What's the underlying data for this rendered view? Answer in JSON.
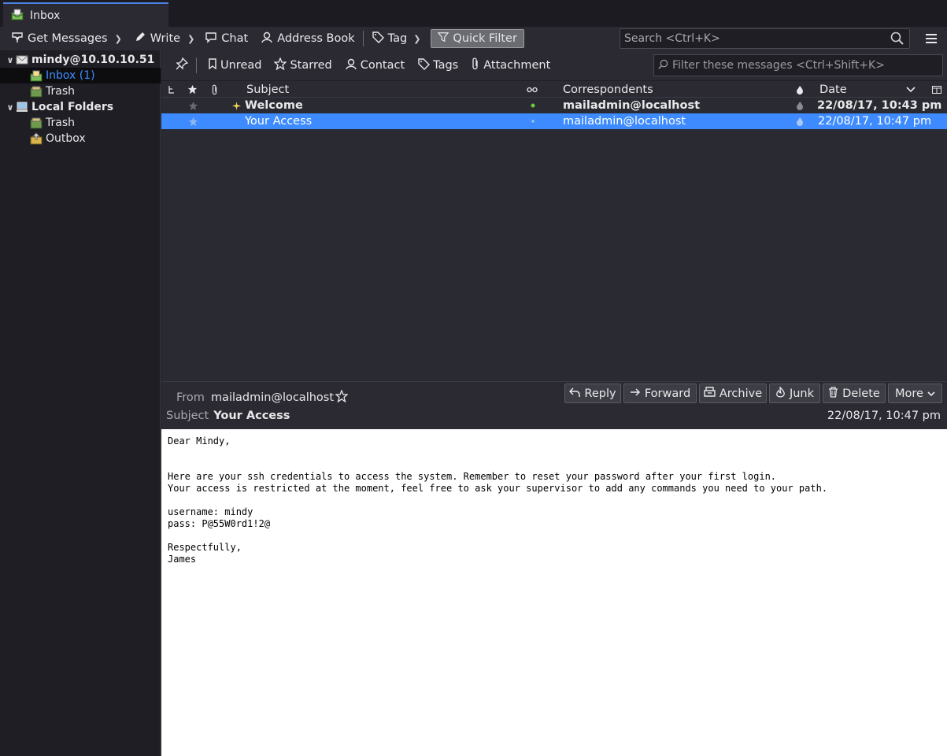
{
  "tabs": [
    {
      "label": "Inbox"
    }
  ],
  "toolbar": {
    "get_messages": "Get Messages",
    "write": "Write",
    "chat": "Chat",
    "address_book": "Address Book",
    "tag": "Tag",
    "quick_filter": "Quick Filter",
    "search_placeholder": "Search <Ctrl+K>"
  },
  "folders": {
    "account": "mindy@10.10.10.51",
    "inbox": "Inbox (1)",
    "trash": "Trash",
    "local_folders": "Local Folders",
    "local_trash": "Trash",
    "outbox": "Outbox"
  },
  "quick_filter_bar": {
    "unread": "Unread",
    "starred": "Starred",
    "contact": "Contact",
    "tags": "Tags",
    "attachment": "Attachment",
    "filter_placeholder": "Filter these messages <Ctrl+Shift+K>"
  },
  "thread_columns": {
    "subject": "Subject",
    "correspondents": "Correspondents",
    "date": "Date"
  },
  "messages": [
    {
      "subject": "Welcome",
      "correspondent": "mailadmin@localhost",
      "date": "22/08/17, 10:43 pm",
      "unread": true,
      "selected": false
    },
    {
      "subject": "Your Access",
      "correspondent": "mailadmin@localhost",
      "date": "22/08/17, 10:47 pm",
      "unread": false,
      "selected": true
    }
  ],
  "message_header": {
    "from_label": "From",
    "from": "mailadmin@localhost",
    "subject_label": "Subject",
    "subject": "Your Access",
    "date": "22/08/17, 10:47 pm",
    "actions": {
      "reply": "Reply",
      "forward": "Forward",
      "archive": "Archive",
      "junk": "Junk",
      "delete": "Delete",
      "more": "More"
    }
  },
  "message_body": {
    "greeting": "Dear Mindy,",
    "line1": "Here are your ssh credentials to access the system. Remember to reset your password after your first login.",
    "line2": "Your access is restricted at the moment, feel free to ask your supervisor to add any commands you need to your path.",
    "username": "username: mindy",
    "password": "pass: P@55W0rd1!2@",
    "closing": "Respectfully,",
    "signature": "James"
  },
  "colors": {
    "accent": "#3d8bff",
    "selected_row": "#3d8bff",
    "unread_dot": "#6ecb3a",
    "star_new": "#f5d35c"
  }
}
